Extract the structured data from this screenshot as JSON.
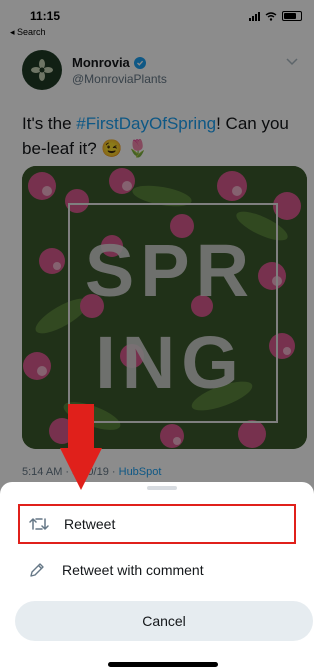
{
  "status_bar": {
    "time": "11:15",
    "back_label": "◂ Search"
  },
  "tweet": {
    "display_name": "Monrovia",
    "handle": "@MonroviaPlants",
    "text_prefix": "It's the ",
    "hashtag": "#FirstDayOfSpring",
    "text_suffix": "! Can you be-leaf it? 😉 🌷",
    "image_text_top": "SPR",
    "image_text_bottom": "ING",
    "timestamp": "5:14 AM · 3/20/19 · ",
    "source": "HubSpot"
  },
  "action_sheet": {
    "items": [
      {
        "label": "Retweet",
        "icon": "retweet-icon"
      },
      {
        "label": "Retweet with comment",
        "icon": "pencil-icon"
      }
    ],
    "cancel_label": "Cancel"
  },
  "colors": {
    "accent": "#1da1f2",
    "highlight": "#e0201b",
    "overlay": "rgba(0,0,0,0.45)"
  }
}
